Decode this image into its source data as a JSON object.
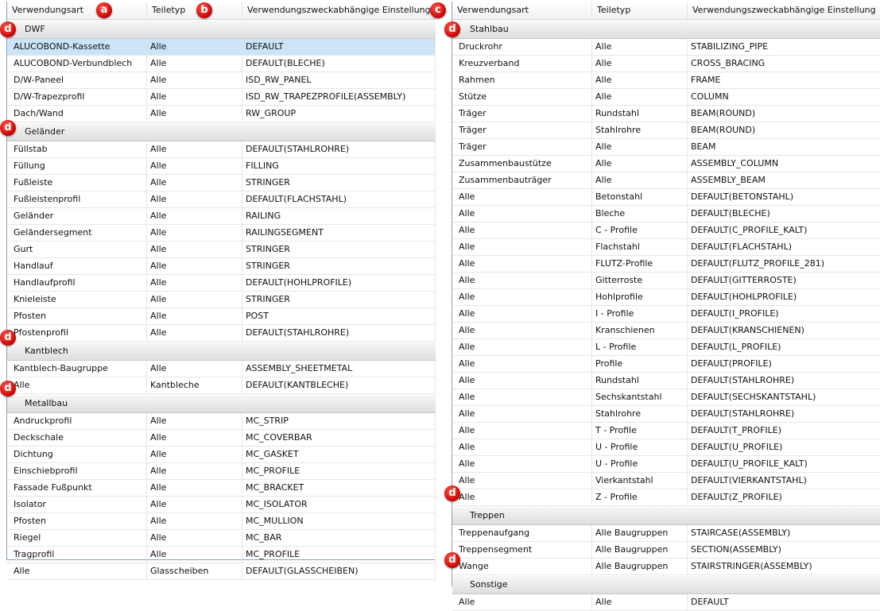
{
  "columns": [
    "Verwendungsart",
    "Teiletyp",
    "Verwendungszweckabhängige Einstellung"
  ],
  "badges": {
    "a": "a",
    "b": "b",
    "c": "c",
    "d": "d"
  },
  "selected_row": "ALUCOBOND-Kassette",
  "left": [
    {
      "name": "DWF",
      "rows": [
        [
          "ALUCOBOND-Kassette",
          "Alle",
          "DEFAULT"
        ],
        [
          "ALUCOBOND-Verbundblech",
          "Alle",
          "DEFAULT(BLECHE)"
        ],
        [
          "D/W-Paneel",
          "Alle",
          "ISD_RW_PANEL"
        ],
        [
          "D/W-Trapezprofil",
          "Alle",
          "ISD_RW_TRAPEZPROFILE(ASSEMBLY)"
        ],
        [
          "Dach/Wand",
          "Alle",
          "RW_GROUP"
        ]
      ]
    },
    {
      "name": "Geländer",
      "rows": [
        [
          "Füllstab",
          "Alle",
          "DEFAULT(STAHLROHRE)"
        ],
        [
          "Füllung",
          "Alle",
          "FILLING"
        ],
        [
          "Fußleiste",
          "Alle",
          "STRINGER"
        ],
        [
          "Fußleistenprofil",
          "Alle",
          "DEFAULT(FLACHSTAHL)"
        ],
        [
          "Geländer",
          "Alle",
          "RAILING"
        ],
        [
          "Geländersegment",
          "Alle",
          "RAILINGSEGMENT"
        ],
        [
          "Gurt",
          "Alle",
          "STRINGER"
        ],
        [
          "Handlauf",
          "Alle",
          "STRINGER"
        ],
        [
          "Handlaufprofil",
          "Alle",
          "DEFAULT(HOHLPROFILE)"
        ],
        [
          "Knieleiste",
          "Alle",
          "STRINGER"
        ],
        [
          "Pfosten",
          "Alle",
          "POST"
        ],
        [
          "Pfostenprofil",
          "Alle",
          "DEFAULT(STAHLROHRE)"
        ]
      ]
    },
    {
      "name": "Kantblech",
      "rows": [
        [
          "Kantblech-Baugruppe",
          "Alle",
          "ASSEMBLY_SHEETMETAL"
        ],
        [
          "Alle",
          "Kantbleche",
          "DEFAULT(KANTBLECHE)"
        ]
      ]
    },
    {
      "name": "Metallbau",
      "rows": [
        [
          "Andruckprofil",
          "Alle",
          "MC_STRIP"
        ],
        [
          "Deckschale",
          "Alle",
          "MC_COVERBAR"
        ],
        [
          "Dichtung",
          "Alle",
          "MC_GASKET"
        ],
        [
          "Einschiebprofil",
          "Alle",
          "MC_PROFILE"
        ],
        [
          "Fassade Fußpunkt",
          "Alle",
          "MC_BRACKET"
        ],
        [
          "Isolator",
          "Alle",
          "MC_ISOLATOR"
        ],
        [
          "Pfosten",
          "Alle",
          "MC_MULLION"
        ],
        [
          "Riegel",
          "Alle",
          "MC_BAR"
        ],
        [
          "Tragprofil",
          "Alle",
          "MC_PROFILE"
        ],
        [
          "Alle",
          "Glasscheiben",
          "DEFAULT(GLASSCHEIBEN)"
        ]
      ]
    }
  ],
  "right": [
    {
      "name": "Stahlbau",
      "rows": [
        [
          "Druckrohr",
          "Alle",
          "STABILIZING_PIPE"
        ],
        [
          "Kreuzverband",
          "Alle",
          "CROSS_BRACING"
        ],
        [
          "Rahmen",
          "Alle",
          "FRAME"
        ],
        [
          "Stütze",
          "Alle",
          "COLUMN"
        ],
        [
          "Träger",
          "Rundstahl",
          "BEAM(ROUND)"
        ],
        [
          "Träger",
          "Stahlrohre",
          "BEAM(ROUND)"
        ],
        [
          "Träger",
          "Alle",
          "BEAM"
        ],
        [
          "Zusammenbaustütze",
          "Alle",
          "ASSEMBLY_COLUMN"
        ],
        [
          "Zusammenbauträger",
          "Alle",
          "ASSEMBLY_BEAM"
        ],
        [
          "Alle",
          "Betonstahl",
          "DEFAULT(BETONSTAHL)"
        ],
        [
          "Alle",
          "Bleche",
          "DEFAULT(BLECHE)"
        ],
        [
          "Alle",
          "C - Profile",
          "DEFAULT(C_PROFILE_KALT)"
        ],
        [
          "Alle",
          "Flachstahl",
          "DEFAULT(FLACHSTAHL)"
        ],
        [
          "Alle",
          "FLUTZ-Profile",
          "DEFAULT(FLUTZ_PROFILE_281)"
        ],
        [
          "Alle",
          "Gitterroste",
          "DEFAULT(GITTERROSTE)"
        ],
        [
          "Alle",
          "Hohlprofile",
          "DEFAULT(HOHLPROFILE)"
        ],
        [
          "Alle",
          "I - Profile",
          "DEFAULT(I_PROFILE)"
        ],
        [
          "Alle",
          "Kranschienen",
          "DEFAULT(KRANSCHIENEN)"
        ],
        [
          "Alle",
          "L - Profile",
          "DEFAULT(L_PROFILE)"
        ],
        [
          "Alle",
          "Profile",
          "DEFAULT(PROFILE)"
        ],
        [
          "Alle",
          "Rundstahl",
          "DEFAULT(STAHLROHRE)"
        ],
        [
          "Alle",
          "Sechskantstahl",
          "DEFAULT(SECHSKANTSTAHL)"
        ],
        [
          "Alle",
          "Stahlrohre",
          "DEFAULT(STAHLROHRE)"
        ],
        [
          "Alle",
          "T - Profile",
          "DEFAULT(T_PROFILE)"
        ],
        [
          "Alle",
          "U - Profile",
          "DEFAULT(U_PROFILE)"
        ],
        [
          "Alle",
          "U - Profile",
          "DEFAULT(U_PROFILE_KALT)"
        ],
        [
          "Alle",
          "Vierkantstahl",
          "DEFAULT(VIERKANTSTAHL)"
        ],
        [
          "Alle",
          "Z - Profile",
          "DEFAULT(Z_PROFILE)"
        ]
      ]
    },
    {
      "name": "Treppen",
      "rows": [
        [
          "Treppenaufgang",
          "Alle Baugruppen",
          "STAIRCASE(ASSEMBLY)"
        ],
        [
          "Treppensegment",
          "Alle Baugruppen",
          "SECTION(ASSEMBLY)"
        ],
        [
          "Wange",
          "Alle Baugruppen",
          "STAIRSTRINGER(ASSEMBLY)"
        ]
      ]
    },
    {
      "name": "Sonstige",
      "rows": [
        [
          "Alle",
          "Alle",
          "DEFAULT"
        ]
      ]
    }
  ]
}
